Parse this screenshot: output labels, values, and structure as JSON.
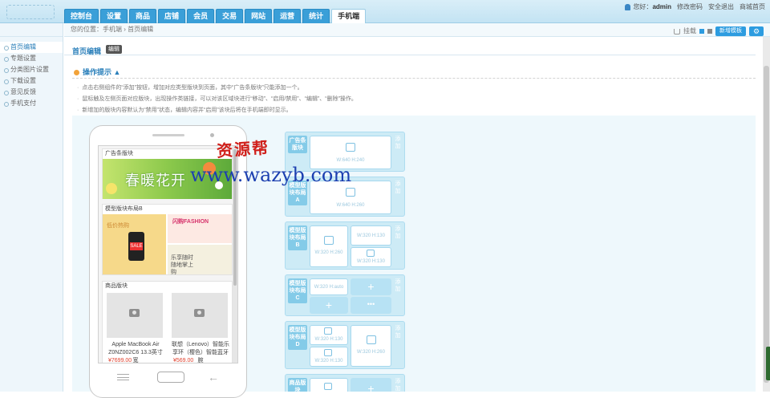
{
  "header": {
    "nav": [
      "控制台",
      "设置",
      "商品",
      "店铺",
      "会员",
      "交易",
      "网站",
      "运营",
      "统计",
      "手机端"
    ],
    "active_nav_index": 9,
    "greeting": "您好：",
    "username": "admin",
    "links": [
      "修改密码",
      "安全退出",
      "商城首页"
    ]
  },
  "sidebar": {
    "items": [
      "首页编辑",
      "专题设置",
      "分类图片设置",
      "下载设置",
      "意见反馈",
      "手机支付"
    ],
    "active_index": 0
  },
  "breadcrumb": {
    "text": "您的位置：手机端 › 首页编辑"
  },
  "toolbar": {
    "item1": "挂载",
    "preview_button": "新增模板"
  },
  "page": {
    "title": "首页编辑",
    "edit_tag": "编辑",
    "tips_title": "操作提示 ▲",
    "tips": [
      "点击右侧组件的“添加”按钮，增加对应类型版块到页面，其中“广告条版块”只能添加一个。",
      "鼠标触及左侧页面对应版块，出现操作类链接，可以对该区域块进行“移动”、“启用/禁用”、“编辑”、“删除”操作。",
      "新增加的版块内容默认为“禁用”状态，编辑内容并“启用”该块后将在手机端即时显示。"
    ]
  },
  "phone_preview": {
    "ad_block_title": "广告条版块",
    "banner_text": "春暖花开",
    "template_block_title": "模型版块布局B",
    "template_texts": {
      "left": "低价热购",
      "right_top": "闪购FASHION",
      "right_bottom": "乐享随时随地掌上购"
    },
    "goods_block_title": "商品版块",
    "goods": [
      {
        "name": "Apple MacBook Air Z0NZ002C6 13.3英寸宽",
        "price": "¥7699.00"
      },
      {
        "name": "联想（Lenovo）智能乐享环（樱色）智能蓝牙腕",
        "price": "¥569.00"
      }
    ]
  },
  "modules": [
    {
      "name": "广告条版块",
      "side": "添加",
      "cells": [
        {
          "dim": "W:640 H:240"
        }
      ]
    },
    {
      "name": "模型版块布局A",
      "side": "添加",
      "cells": [
        {
          "dim": "W:640 H:260"
        }
      ]
    },
    {
      "name": "模型版块布局B",
      "side": "添加",
      "cells": [
        {
          "dim": "W:320 H:260"
        },
        {
          "dim": "W:320 H:130"
        },
        {
          "dim": "W:320 H:130"
        }
      ]
    },
    {
      "name": "模型版块布局C",
      "side": "添加",
      "cells": [
        {
          "dim": "W:320 H:auto"
        }
      ]
    },
    {
      "name": "模型版块布局D",
      "side": "添加",
      "cells": [
        {
          "dim": "W:320 H:130"
        },
        {
          "dim": "W:320 H:130"
        },
        {
          "dim": "W:320 H:260"
        }
      ]
    },
    {
      "name": "商品版块",
      "side": "添加",
      "cells": []
    }
  ],
  "watermark": {
    "cn": "资源帮",
    "url": "www.wazyb.com"
  },
  "colors": {
    "accent": "#2d9ce0",
    "nav_blue": "#3a9fd8",
    "price_red": "#e0422f"
  }
}
